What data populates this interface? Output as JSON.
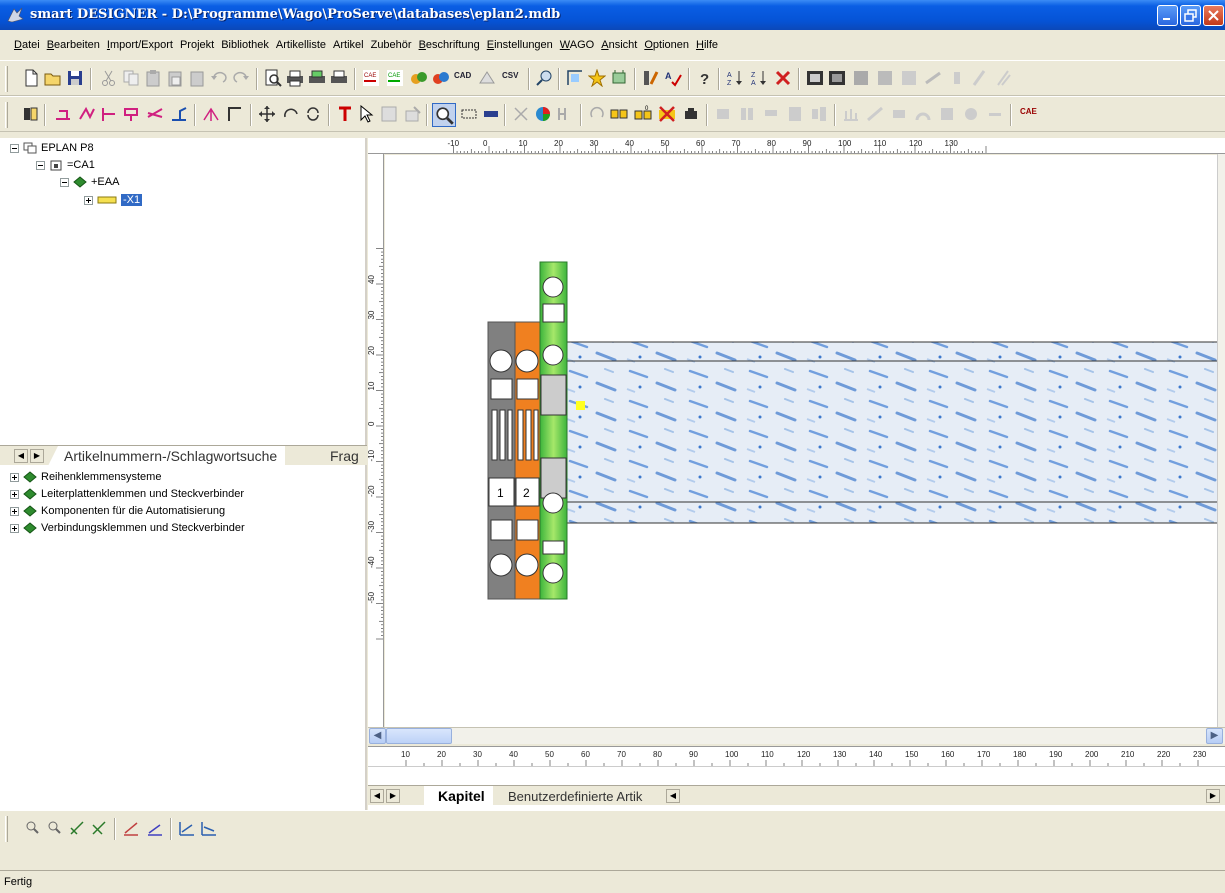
{
  "window": {
    "title": "smart DESIGNER - D:\\Programme\\Wago\\ProServe\\databases\\eplan2.mdb"
  },
  "menu": [
    {
      "label": "Datei",
      "u": "D"
    },
    {
      "label": "Bearbeiten",
      "u": "B"
    },
    {
      "label": "Import/Export",
      "u": "I"
    },
    {
      "label": "Projekt",
      "u": ""
    },
    {
      "label": "Bibliothek",
      "u": ""
    },
    {
      "label": "Artikelliste",
      "u": ""
    },
    {
      "label": "Artikel",
      "u": ""
    },
    {
      "label": "Zubehör",
      "u": ""
    },
    {
      "label": "Beschriftung",
      "u": "B"
    },
    {
      "label": "Einstellungen",
      "u": "E"
    },
    {
      "label": "WAGO",
      "u": "W"
    },
    {
      "label": "Ansicht",
      "u": "A"
    },
    {
      "label": "Optionen",
      "u": "O"
    },
    {
      "label": "Hilfe",
      "u": "H"
    }
  ],
  "toolbar": {
    "cad_label": "CAD",
    "csv_label": "CSV",
    "cae_label": "CAE"
  },
  "tree": {
    "root": "EPLAN P8",
    "level1": "=CA1",
    "level2": "+EAA",
    "level3": "-X1"
  },
  "left_tabs": {
    "active": "Artikelnummern-/Schlagwortsuche",
    "next": "Frag"
  },
  "catalog": [
    "Reihenklemmensysteme",
    "Leiterplattenklemmen und Steckverbinder",
    "Komponenten für die Automatisierung",
    "Verbindungsklemmen und Steckverbinder"
  ],
  "ruler_top": [
    "-10",
    "0",
    "10",
    "20",
    "30",
    "40",
    "50",
    "60",
    "70",
    "80",
    "90",
    "100",
    "110",
    "120",
    "130"
  ],
  "ruler_left": [
    "40",
    "30",
    "20",
    "10",
    "0",
    "-10",
    "-20",
    "-30",
    "-40",
    "-50"
  ],
  "ruler_lower": [
    "10",
    "20",
    "30",
    "40",
    "50",
    "60",
    "70",
    "80",
    "90",
    "100",
    "110",
    "120",
    "130",
    "140",
    "150",
    "160",
    "170",
    "180",
    "190",
    "200",
    "210",
    "220",
    "230"
  ],
  "terminals": {
    "label_1": "1",
    "label_2": "2",
    "color_grey": "#808080",
    "color_orange": "#f08020",
    "color_green": "#66cc33",
    "rail_color": "#7aa6e0"
  },
  "bottom_tabs": {
    "active": "Kapitel",
    "inactive": "Benutzerdefinierte Artik"
  },
  "status": {
    "text": "Fertig"
  }
}
